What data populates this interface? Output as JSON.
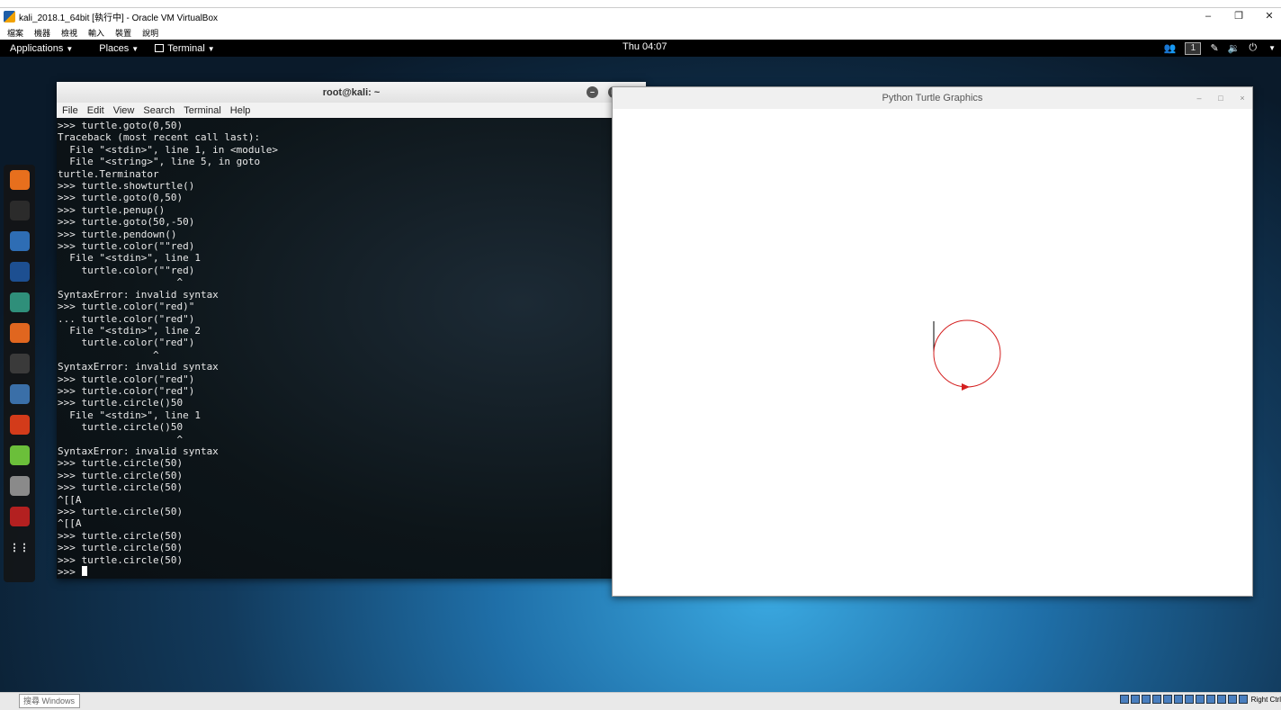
{
  "vbox": {
    "title": "kali_2018.1_64bit [執行中] - Oracle VM VirtualBox",
    "menu": [
      "檔案",
      "機器",
      "檢視",
      "輸入",
      "裝置",
      "說明"
    ],
    "minimize": "–",
    "restore": "❐",
    "close": "✕"
  },
  "panel": {
    "applications": "Applications",
    "places": "Places",
    "terminal": "Terminal",
    "clock": "Thu 04:07",
    "workspace": "1"
  },
  "dock": {
    "items": [
      {
        "icon": "firefox-icon",
        "color": "#e76f1d"
      },
      {
        "icon": "terminal-icon",
        "color": "#2b2b2b"
      },
      {
        "icon": "files-icon",
        "color": "#2e6db4"
      },
      {
        "icon": "metasploit-icon",
        "color": "#1d4f91"
      },
      {
        "icon": "armitage-icon",
        "color": "#2f8f7a"
      },
      {
        "icon": "burpsuite-icon",
        "color": "#e0661f"
      },
      {
        "icon": "maltego-icon",
        "color": "#3a3a3a"
      },
      {
        "icon": "beef-icon",
        "color": "#3a6fa8"
      },
      {
        "icon": "faraday-icon",
        "color": "#d33b1a"
      },
      {
        "icon": "leafpad-icon",
        "color": "#6bbf3a"
      },
      {
        "icon": "cherrytree-icon",
        "color": "#8a8a8a"
      },
      {
        "icon": "recordmydesktop-icon",
        "color": "#b32020"
      },
      {
        "icon": "show-apps-icon",
        "color": "transparent"
      }
    ]
  },
  "terminal": {
    "title": "root@kali: ~",
    "menu": [
      "File",
      "Edit",
      "View",
      "Search",
      "Terminal",
      "Help"
    ],
    "lines": [
      ">>> turtle.goto(0,50)",
      "Traceback (most recent call last):",
      "  File \"<stdin>\", line 1, in <module>",
      "  File \"<string>\", line 5, in goto",
      "turtle.Terminator",
      ">>> turtle.showturtle()",
      ">>> turtle.goto(0,50)",
      ">>> turtle.penup()",
      ">>> turtle.goto(50,-50)",
      ">>> turtle.pendown()",
      ">>> turtle.color(\"\"red)",
      "  File \"<stdin>\", line 1",
      "    turtle.color(\"\"red)",
      "                    ^",
      "SyntaxError: invalid syntax",
      ">>> turtle.color(\"red)\"",
      "... turtle.color(\"red\")",
      "  File \"<stdin>\", line 2",
      "    turtle.color(\"red\")",
      "                ^",
      "SyntaxError: invalid syntax",
      ">>> turtle.color(\"red\")",
      ">>> turtle.color(\"red\")",
      ">>> turtle.circle()50",
      "  File \"<stdin>\", line 1",
      "    turtle.circle()50",
      "                    ^",
      "SyntaxError: invalid syntax",
      ">>> turtle.circle(50)",
      ">>> turtle.circle(50)",
      ">>> turtle.circle(50)",
      "^[[A",
      ">>> turtle.circle(50)",
      "^[[A",
      ">>> turtle.circle(50)",
      ">>> turtle.circle(50)",
      ">>> turtle.circle(50)"
    ],
    "prompt": ">>> "
  },
  "turtle_window": {
    "title": "Python Turtle Graphics",
    "pen_color": "#d42020"
  },
  "taskbar": {
    "search": "搜尋 Windows",
    "tray_label": "Right Ctrl"
  }
}
